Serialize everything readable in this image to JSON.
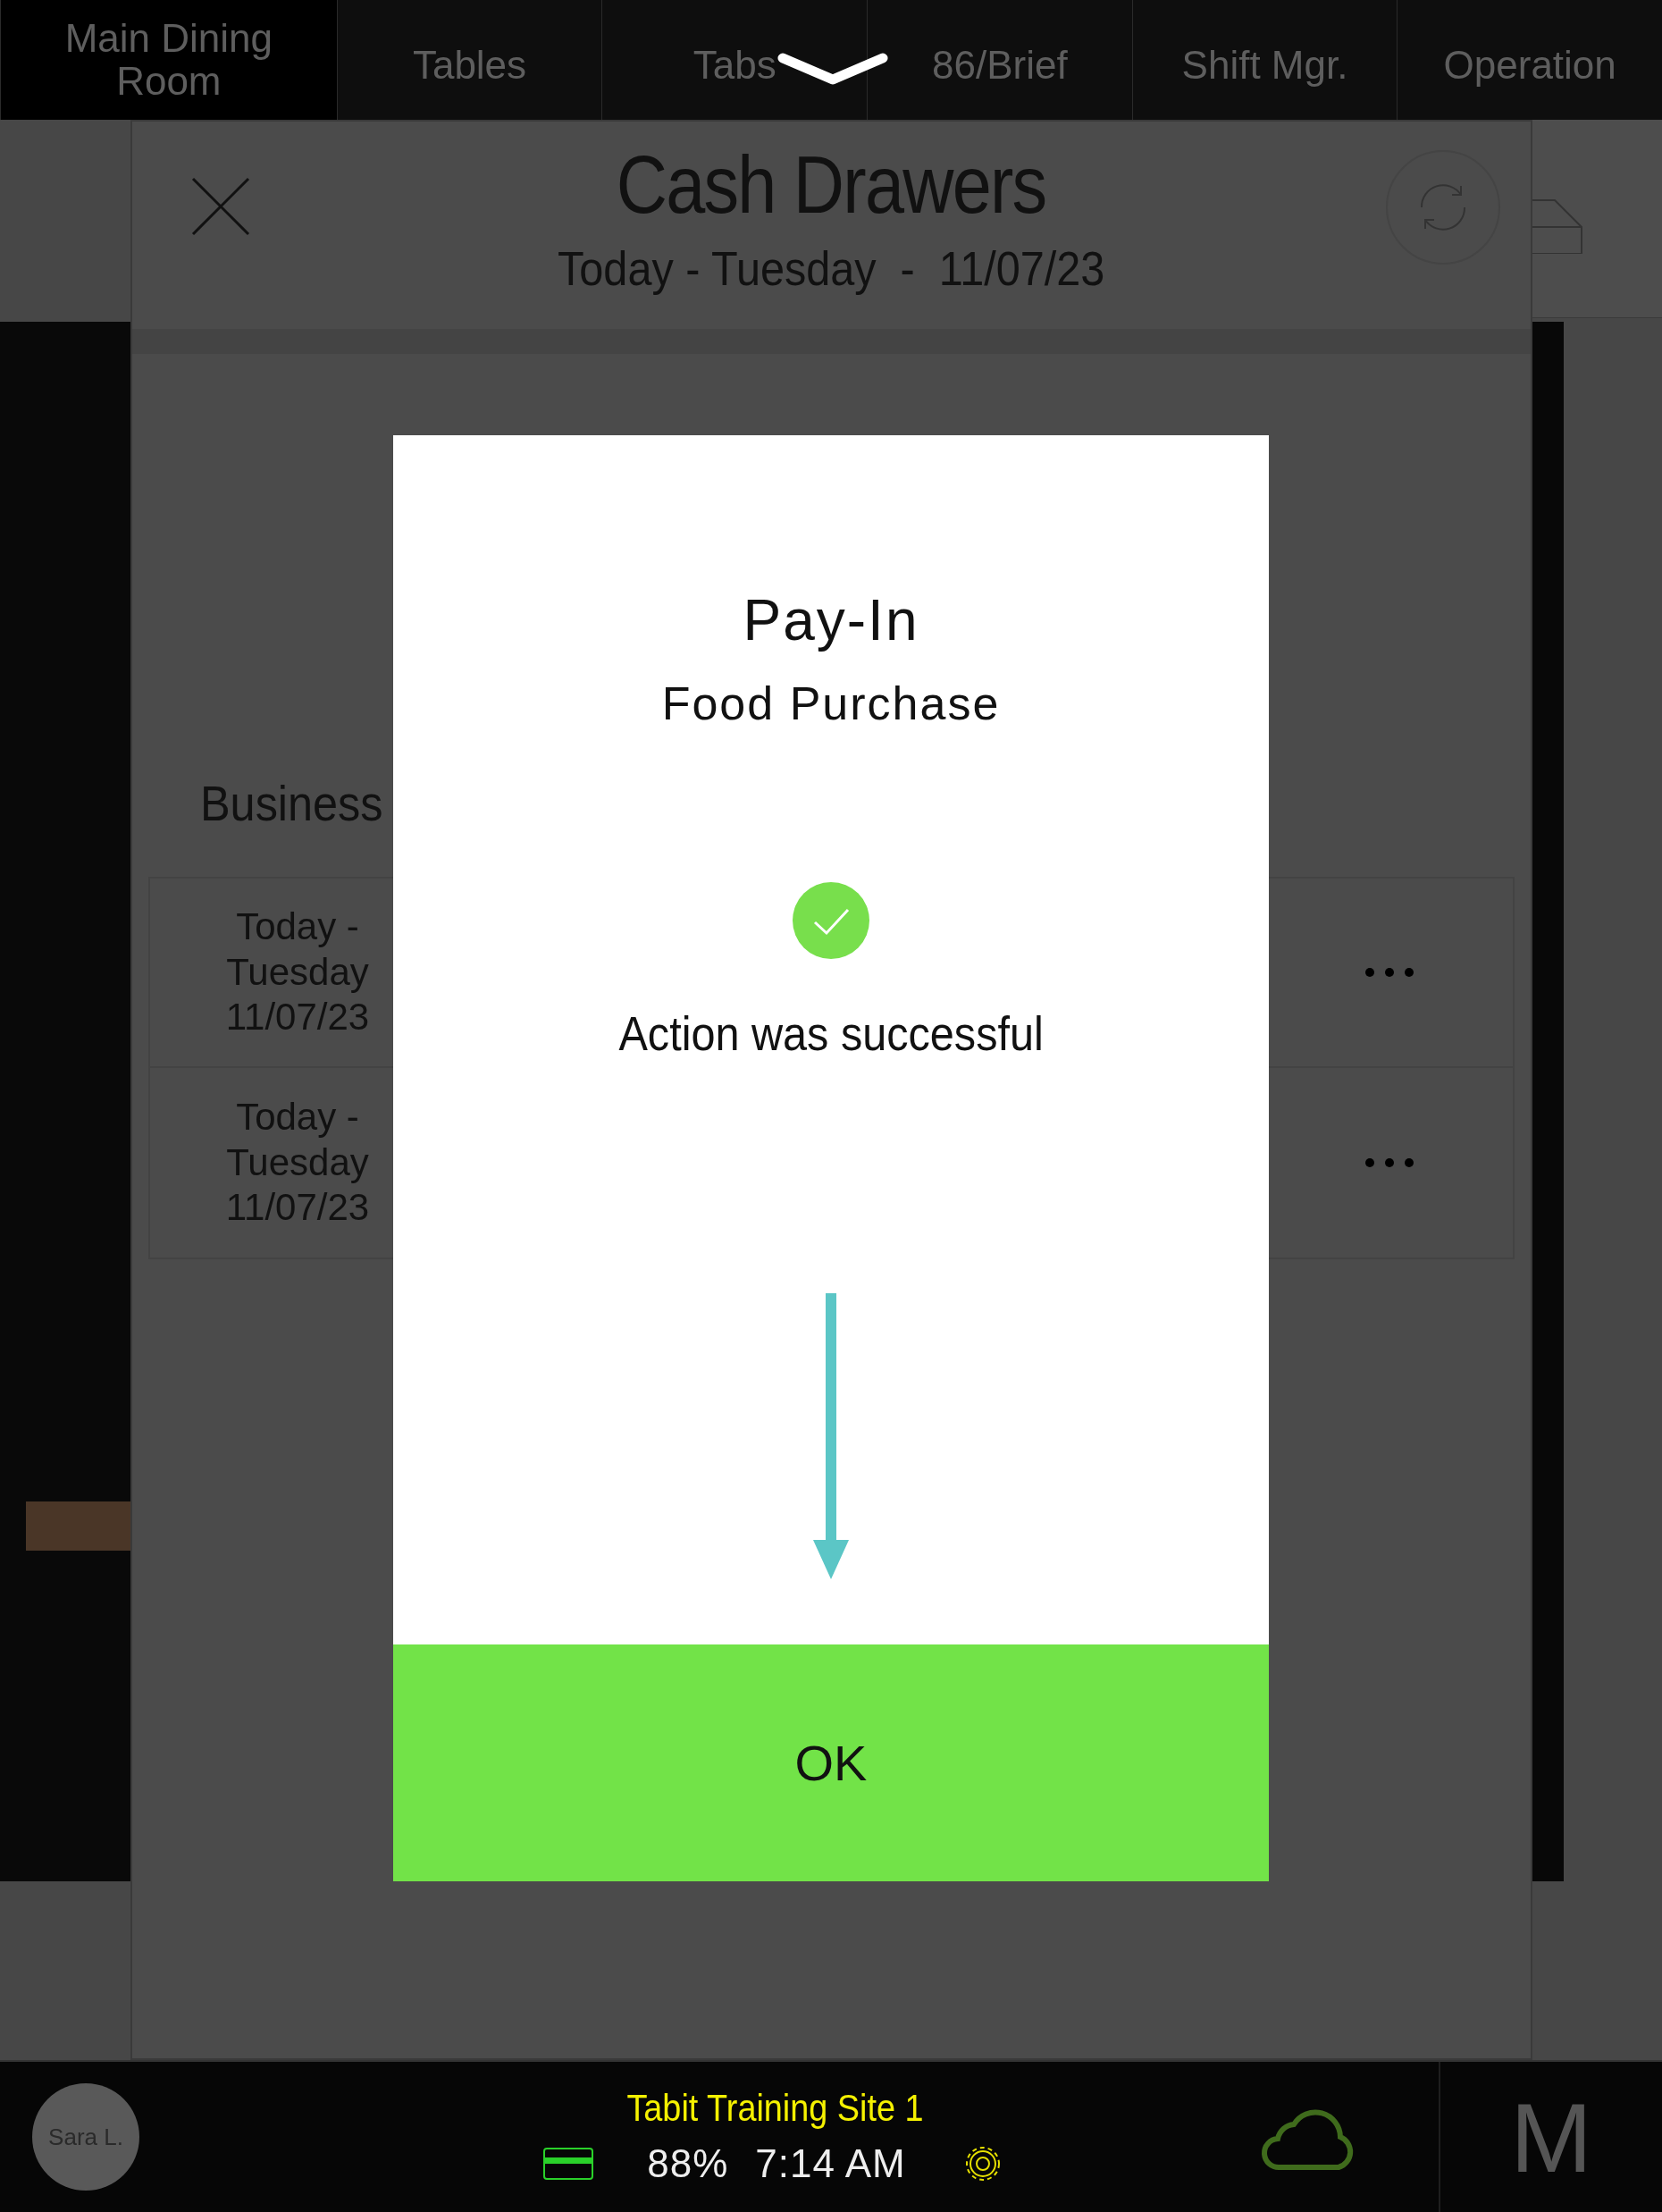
{
  "nav": {
    "tabs": [
      {
        "label": "Main Dining Room",
        "selected": true
      },
      {
        "label": "Tables",
        "selected": false
      },
      {
        "label": "Tabs",
        "selected": false
      },
      {
        "label": "86/Brief",
        "selected": false
      },
      {
        "label": "Shift Mgr.",
        "selected": false
      },
      {
        "label": "Operation",
        "selected": false
      }
    ]
  },
  "panel": {
    "title": "Cash Drawers",
    "subtitle": "Today - Tuesday  -  11/07/23",
    "section": "Business",
    "rows": [
      {
        "date": "Today - Tuesday 11/07/23"
      },
      {
        "date": "Today - Tuesday 11/07/23"
      }
    ]
  },
  "dialog": {
    "title": "Pay-In",
    "subtitle": "Food Purchase",
    "message": "Action was successful",
    "button": "OK"
  },
  "bottom": {
    "user": "Sara L.",
    "site": "Tabit Training Site 1",
    "battery": "88%",
    "time": "7:14 AM",
    "logo": "M"
  }
}
